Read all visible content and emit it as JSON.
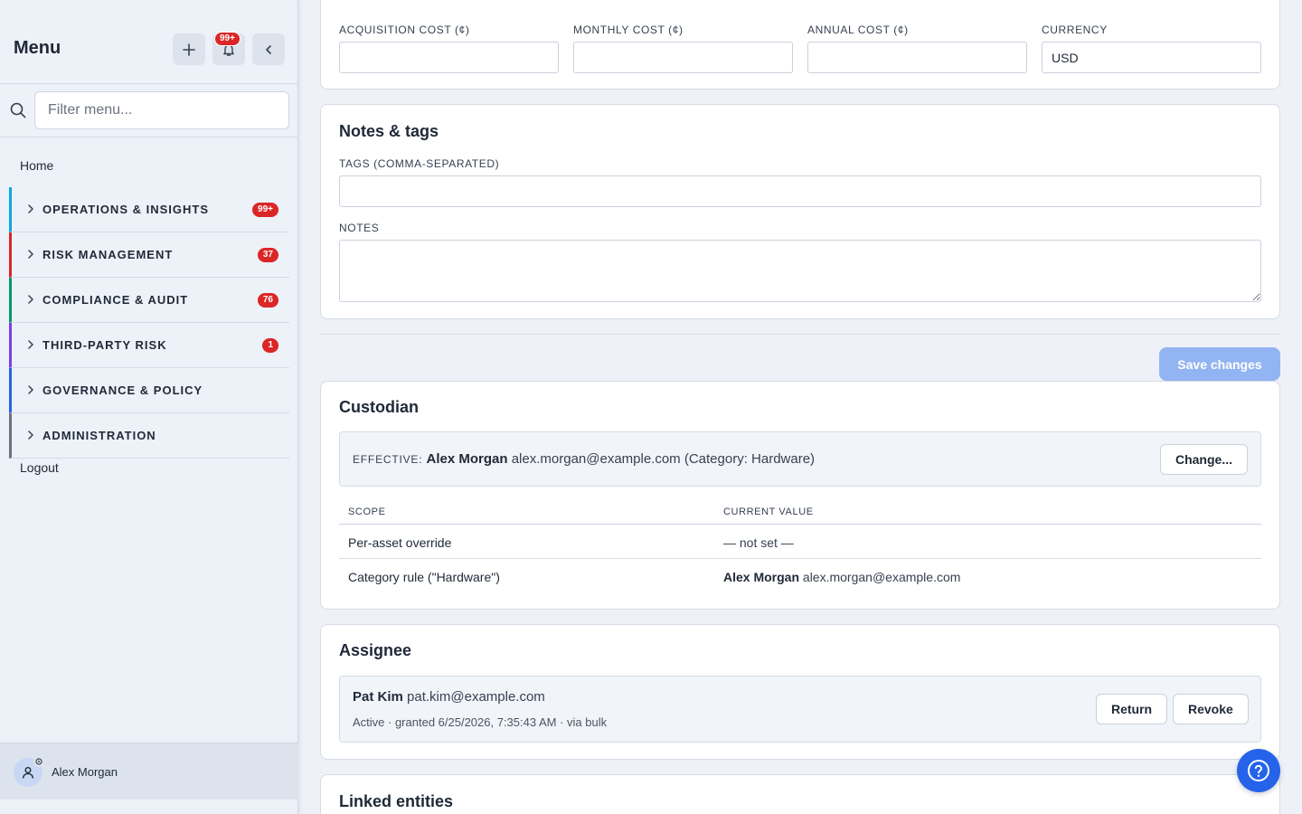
{
  "sidebar": {
    "title": "Menu",
    "notification_badge": "99+",
    "filter_placeholder": "Filter menu...",
    "home": "Home",
    "groups": [
      {
        "label": "OPERATIONS & INSIGHTS",
        "badge": "99+",
        "accent": "#0ea5e9"
      },
      {
        "label": "RISK MANAGEMENT",
        "badge": "37",
        "accent": "#dc2626"
      },
      {
        "label": "COMPLIANCE & AUDIT",
        "badge": "76",
        "accent": "#059669"
      },
      {
        "label": "THIRD-PARTY RISK",
        "badge": "1",
        "accent": "#7c3aed"
      },
      {
        "label": "GOVERNANCE & POLICY",
        "badge": "",
        "accent": "#2563eb"
      },
      {
        "label": "ADMINISTRATION",
        "badge": "",
        "accent": "#6b7280"
      }
    ],
    "logout": "Logout",
    "user_name": "Alex Morgan"
  },
  "cost": {
    "acquisition_label": "ACQUISITION COST (¢)",
    "acquisition_value": "",
    "monthly_label": "MONTHLY COST (¢)",
    "monthly_value": "",
    "annual_label": "ANNUAL COST (¢)",
    "annual_value": "",
    "currency_label": "CURRENCY",
    "currency_value": "USD"
  },
  "notes": {
    "title": "Notes & tags",
    "tags_label": "TAGS (COMMA-SEPARATED)",
    "tags_value": "",
    "notes_label": "NOTES",
    "notes_value": ""
  },
  "save_label": "Save changes",
  "custodian": {
    "title": "Custodian",
    "effective_prefix": "EFFECTIVE:",
    "effective_name": "Alex Morgan",
    "effective_rest": "alex.morgan@example.com (Category: Hardware)",
    "change_label": "Change...",
    "col_scope": "SCOPE",
    "col_value": "CURRENT VALUE",
    "row1_scope": "Per-asset override",
    "row1_value": "— not set —",
    "row2_scope": "Category rule (\"Hardware\")",
    "row2_name": "Alex Morgan",
    "row2_email": "alex.morgan@example.com"
  },
  "assignee": {
    "title": "Assignee",
    "name": "Pat Kim",
    "email": "pat.kim@example.com",
    "status": "Active · granted 6/25/2026, 7:35:43 AM · via bulk",
    "return_label": "Return",
    "revoke_label": "Revoke"
  },
  "linked": {
    "title": "Linked entities"
  },
  "colors": {
    "primary": "#2563eb",
    "badge_red": "#dc2626",
    "save_disabled": "#93b4f2"
  }
}
